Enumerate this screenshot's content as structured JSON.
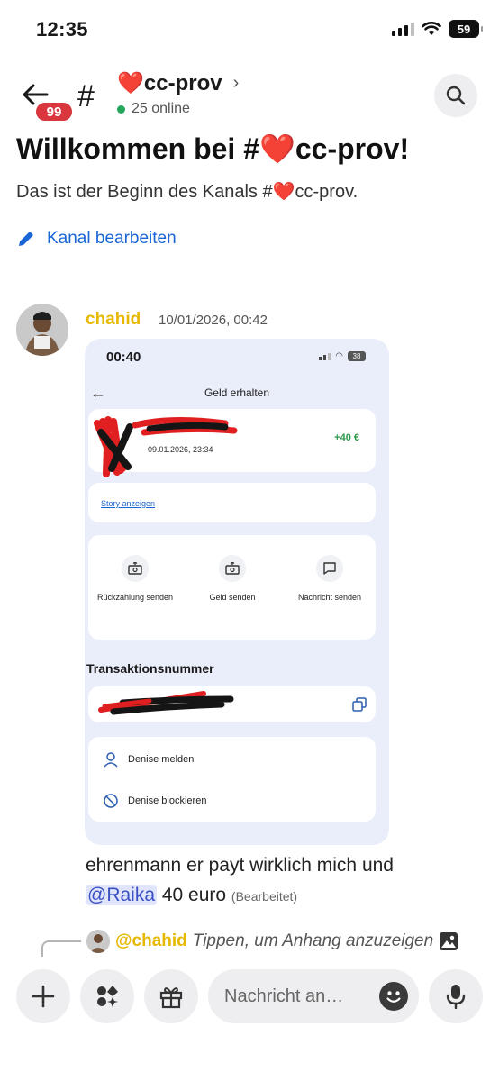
{
  "status_bar": {
    "time": "12:35",
    "battery": "59"
  },
  "header": {
    "badge_count": "99",
    "channel_name": "❤️cc-prov",
    "online_text": "25 online"
  },
  "welcome": {
    "title": "Willkommen bei #❤️cc-prov!",
    "subtitle": "Das ist der Beginn des Kanals #❤️cc-prov.",
    "edit_link": "Kanal bearbeiten"
  },
  "message": {
    "author": "chahid",
    "timestamp": "10/01/2026, 00:42",
    "text_before": "ehrenmann er payt wirklich mich und",
    "mention": "@Raika",
    "text_after": " 40 euro ",
    "edited": "(Bearbeitet)"
  },
  "attachment": {
    "time": "00:40",
    "battery": "38",
    "title": "Geld erhalten",
    "amount": "+40 €",
    "date": "09.01.2026, 23:34",
    "story_link": "Story anzeigen",
    "actions": [
      {
        "label": "Rückzahlung senden"
      },
      {
        "label": "Geld senden"
      },
      {
        "label": "Nachricht senden"
      }
    ],
    "transaction_label": "Transaktionsnummer",
    "report": "Denise melden",
    "block": "Denise blockieren"
  },
  "reply": {
    "name": "@chahid",
    "hint": "Tippen, um Anhang anzuzeigen"
  },
  "composer": {
    "placeholder": "Nachricht an…"
  },
  "colors": {
    "accent": "#1a66d6",
    "badge": "#d9363e",
    "author": "#e6b800",
    "online": "#23a55a",
    "amount": "#2b9a4a"
  }
}
